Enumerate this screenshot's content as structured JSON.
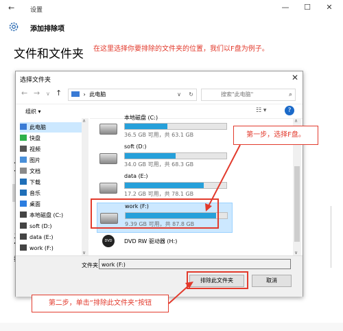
{
  "settings": {
    "window_title": "设置",
    "back_glyph": "←",
    "min_glyph": "—",
    "max_glyph": "☐",
    "close_glyph": "✕",
    "subheader": "添加排除项",
    "heading": "文件和文件夹",
    "annotation": "在这里选择你要排除的文件夹的位置，我们以F盘为例子。"
  },
  "dialog": {
    "title": "选择文件夹",
    "close_glyph": "✕",
    "path": "此电脑",
    "path_sep": "›",
    "search_placeholder": "搜索\"此电脑\"",
    "organize": "组织 ▾",
    "nav_items": [
      {
        "label": "此电脑",
        "icon": "computer-icon",
        "color": "#3a7bd5"
      },
      {
        "label": "快盘",
        "icon": "cloud-drive-icon",
        "color": "#2db14a"
      },
      {
        "label": "视频",
        "icon": "video-icon",
        "color": "#555555"
      },
      {
        "label": "图片",
        "icon": "picture-icon",
        "color": "#4a90d9"
      },
      {
        "label": "文档",
        "icon": "document-icon",
        "color": "#8a8a8a"
      },
      {
        "label": "下载",
        "icon": "download-icon",
        "color": "#1f6fb8"
      },
      {
        "label": "音乐",
        "icon": "music-icon",
        "color": "#1f6fb8"
      },
      {
        "label": "桌面",
        "icon": "desktop-icon",
        "color": "#2b7de0"
      },
      {
        "label": "本地磁盘 (C:)",
        "icon": "drive-icon",
        "color": "#444444"
      },
      {
        "label": "soft (D:)",
        "icon": "drive-icon",
        "color": "#444444"
      },
      {
        "label": "data (E:)",
        "icon": "drive-icon",
        "color": "#444444"
      },
      {
        "label": "work (F:)",
        "icon": "drive-icon",
        "color": "#444444"
      }
    ],
    "drives": [
      {
        "name": "本地磁盘 (C:)",
        "size": "36.5 GB 可用，共 63.1 GB",
        "used_fraction": 0.42
      },
      {
        "name": "soft (D:)",
        "size": "34.0 GB 可用，共 68.3 GB",
        "used_fraction": 0.5
      },
      {
        "name": "data (E:)",
        "size": "17.2 GB 可用，共 78.1 GB",
        "used_fraction": 0.78
      },
      {
        "name": "work (F:)",
        "size": "9.39 GB 可用，共 87.8 GB",
        "used_fraction": 0.89
      }
    ],
    "dvd": "DVD RW 驱动器 (H:)",
    "dvd_badge": "DVD",
    "folder_label": "文件夹:",
    "folder_value": "work (F:)",
    "select_button": "排除此文件夹",
    "cancel_button": "取消"
  },
  "callouts": {
    "step1": "第一步，选择F盘。",
    "step2": "第二步，单击“排除此文件夹”按钮"
  },
  "colors": {
    "accent": "#26a0da",
    "annotation": "#e23a2c",
    "selection": "#cce8ff"
  }
}
